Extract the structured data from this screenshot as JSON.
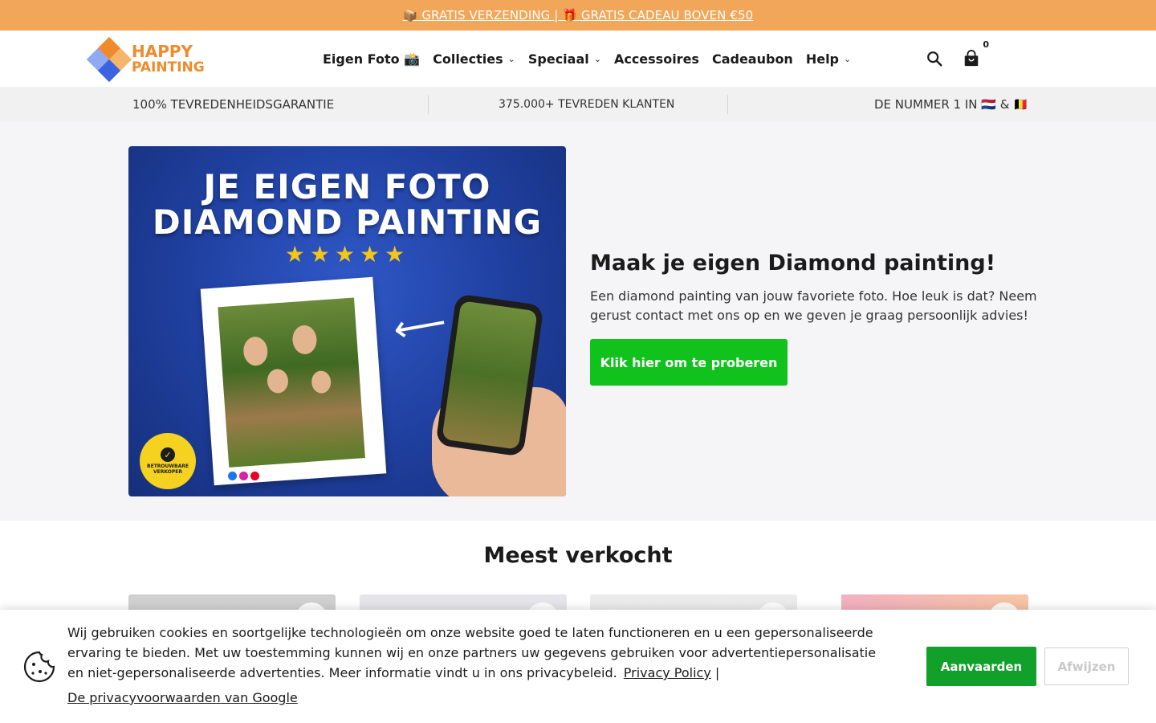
{
  "announcement": {
    "text": "📦 GRATIS VERZENDING | 🎁 GRATIS CADEAU BOVEN €50"
  },
  "header": {
    "logo": {
      "line1": "HAPPY",
      "line2": "PAINTING"
    },
    "nav": [
      {
        "label": "Eigen Foto 📸",
        "has_dropdown": false
      },
      {
        "label": "Collecties",
        "has_dropdown": true
      },
      {
        "label": "Speciaal",
        "has_dropdown": true
      },
      {
        "label": "Accessoires",
        "has_dropdown": false
      },
      {
        "label": "Cadeaubon",
        "has_dropdown": false
      },
      {
        "label": "Help",
        "has_dropdown": true
      }
    ],
    "icons": {
      "search": "search-icon",
      "cart": "shopping-bag-icon"
    },
    "cart_count": "0"
  },
  "usp": {
    "items": [
      {
        "label": "100% TEVREDENHEIDSGARANTIE"
      },
      {
        "label": "375.000+ TEVREDEN KLANTEN"
      },
      {
        "label": "DE NUMMER 1 IN 🇳🇱 & 🇧🇪"
      }
    ]
  },
  "hero": {
    "image": {
      "title_line1": "JE EIGEN FOTO",
      "title_line2": "DIAMOND PAINTING",
      "stars": "★★★★★",
      "badge": "BETROUWBARE VERKOPER"
    },
    "heading": "Maak je eigen Diamond painting!",
    "text": "Een diamond painting van jouw favoriete foto. Hoe leuk is dat? Neem gerust contact met ons op en we geven je graag persoonlijk advies!",
    "cta": "Klik hier om te proberen"
  },
  "best_sellers": {
    "heading": "Meest verkocht"
  },
  "cookie": {
    "text": "Wij gebruiken cookies en soortgelijke technologieën om onze website goed te laten functioneren en u een gepersonaliseerde ervaring te bieden. Met uw toestemming kunnen wij en onze partners uw gegevens gebruiken voor advertentiepersonalisatie en niet-gepersonaliseerde advertenties. Meer informatie vindt u in ons privacybeleid.",
    "privacy_link": "Privacy Policy",
    "separator": "|",
    "google_link": "De privacyvoorwaarden van Google",
    "accept": "Aanvaarden",
    "reject": "Afwijzen"
  },
  "colors": {
    "announcement_bg": "#f2a65a",
    "cta_green": "#11c21d",
    "accept_green": "#11a02a",
    "logo_orange": "#f08a2c"
  }
}
